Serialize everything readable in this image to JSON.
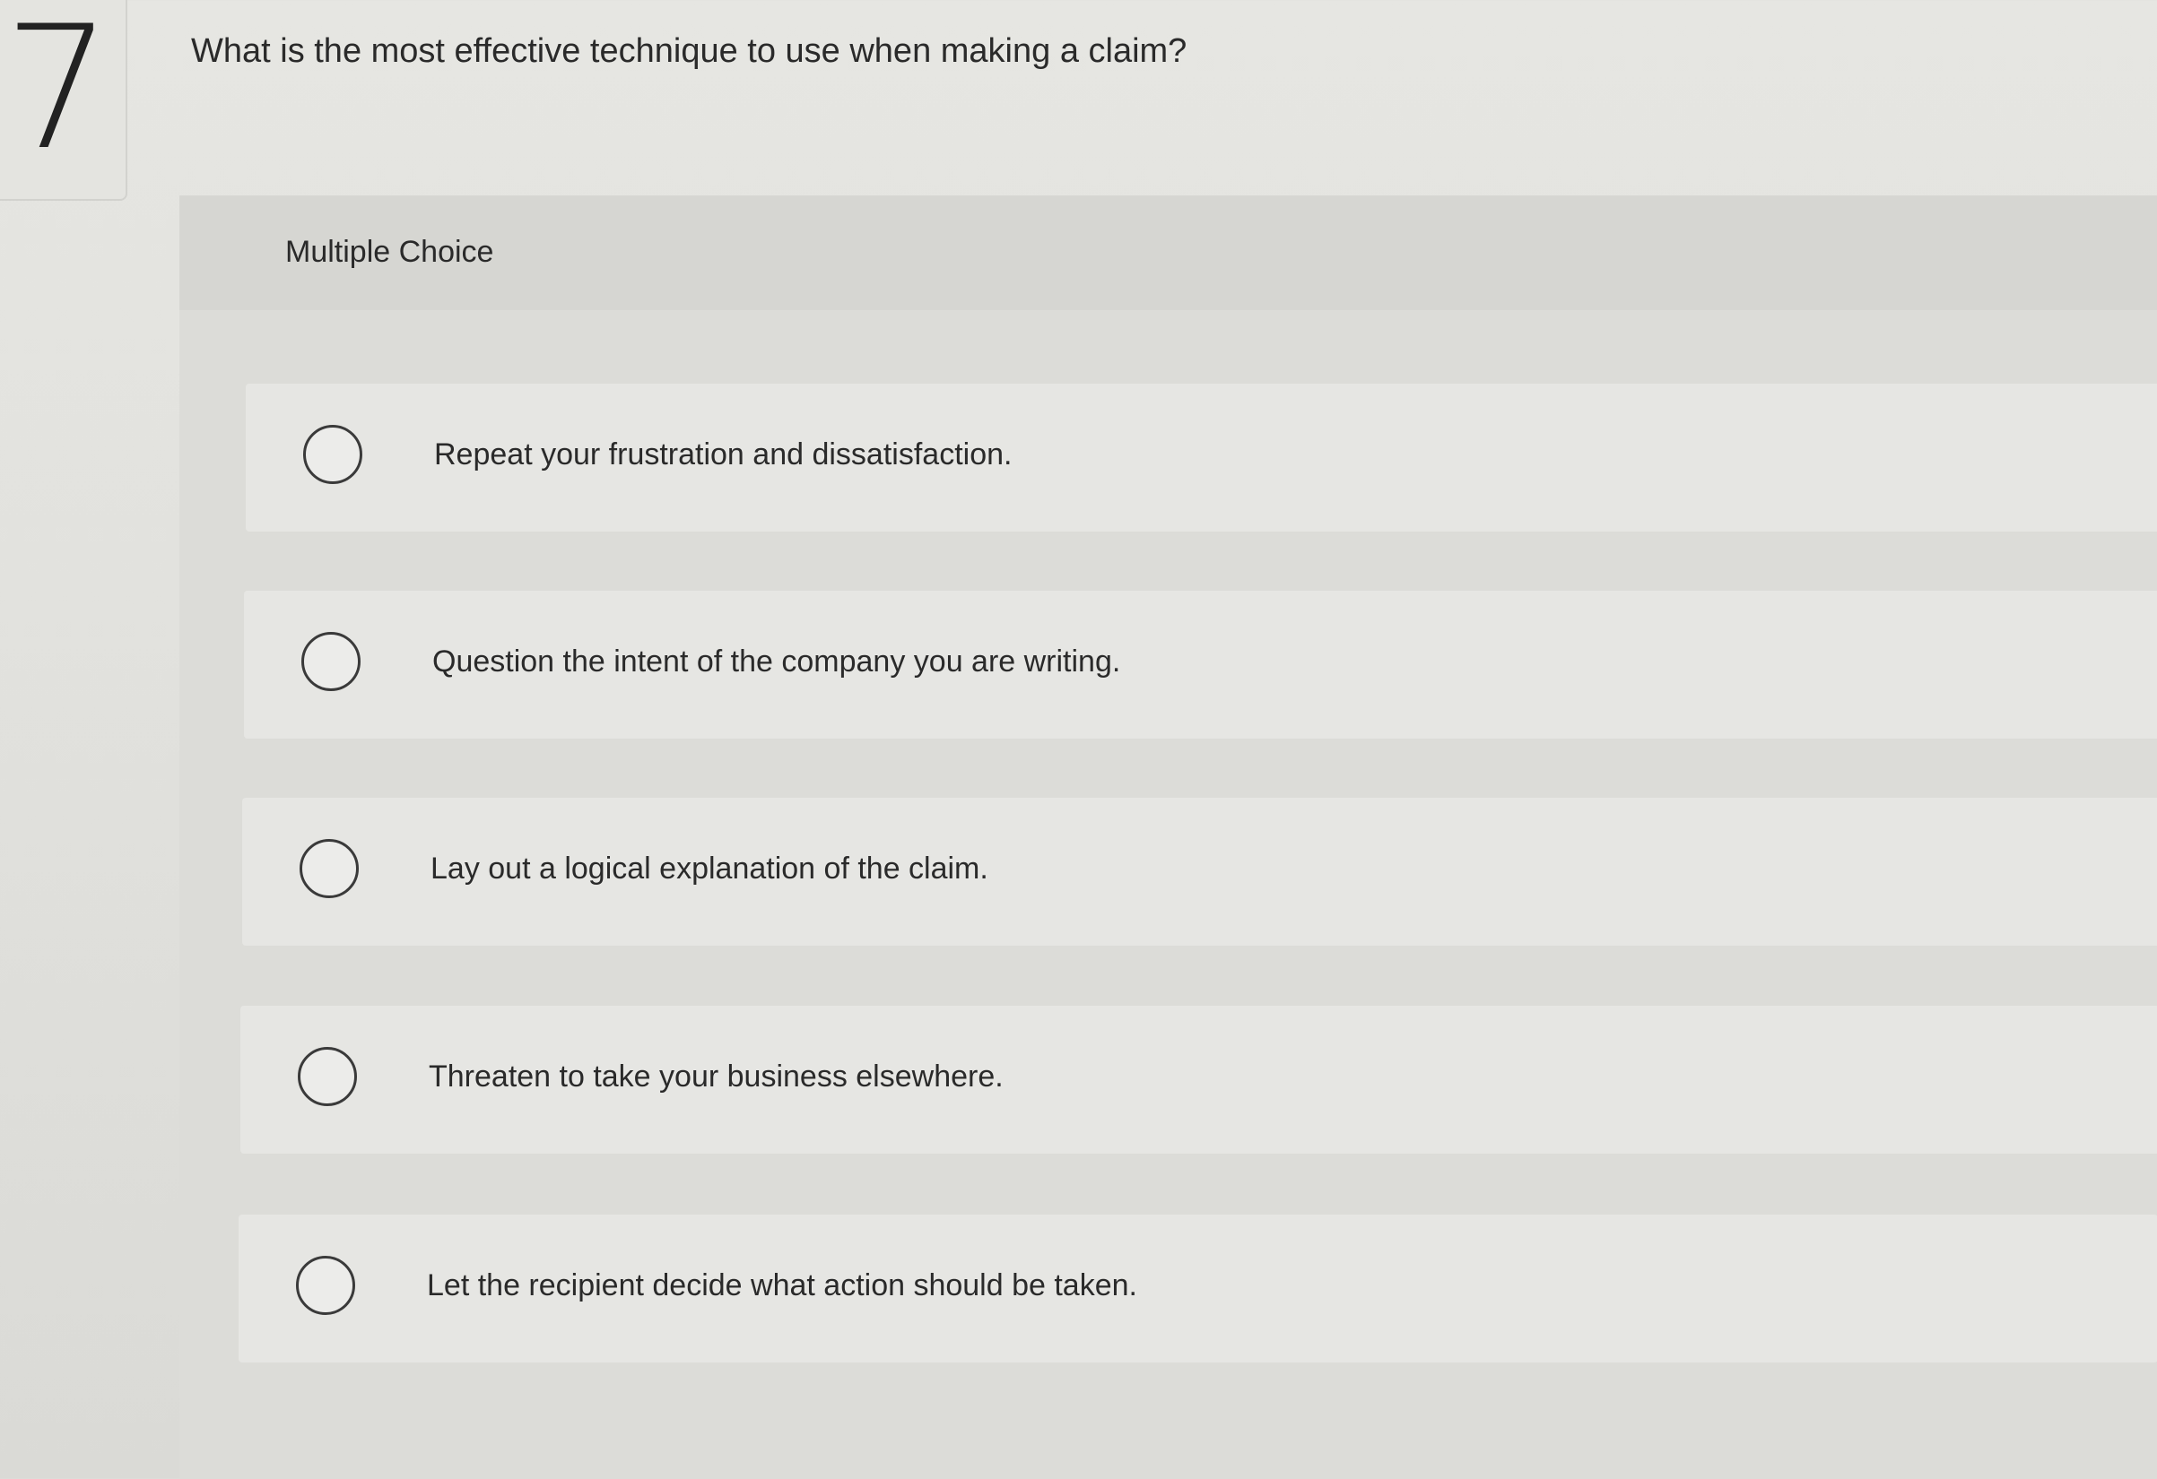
{
  "question": {
    "number": "7",
    "prompt": "What is the most effective technique to use when making a claim?"
  },
  "answer_panel": {
    "type_label": "Multiple Choice",
    "options": [
      {
        "label": "Repeat your frustration and dissatisfaction.",
        "selected": false
      },
      {
        "label": "Question the intent of the company you are writing.",
        "selected": false
      },
      {
        "label": "Lay out a logical explanation of the claim.",
        "selected": false
      },
      {
        "label": "Threaten to take your business elsewhere.",
        "selected": false
      },
      {
        "label": "Let the recipient decide what action should be taken.",
        "selected": false
      }
    ]
  }
}
